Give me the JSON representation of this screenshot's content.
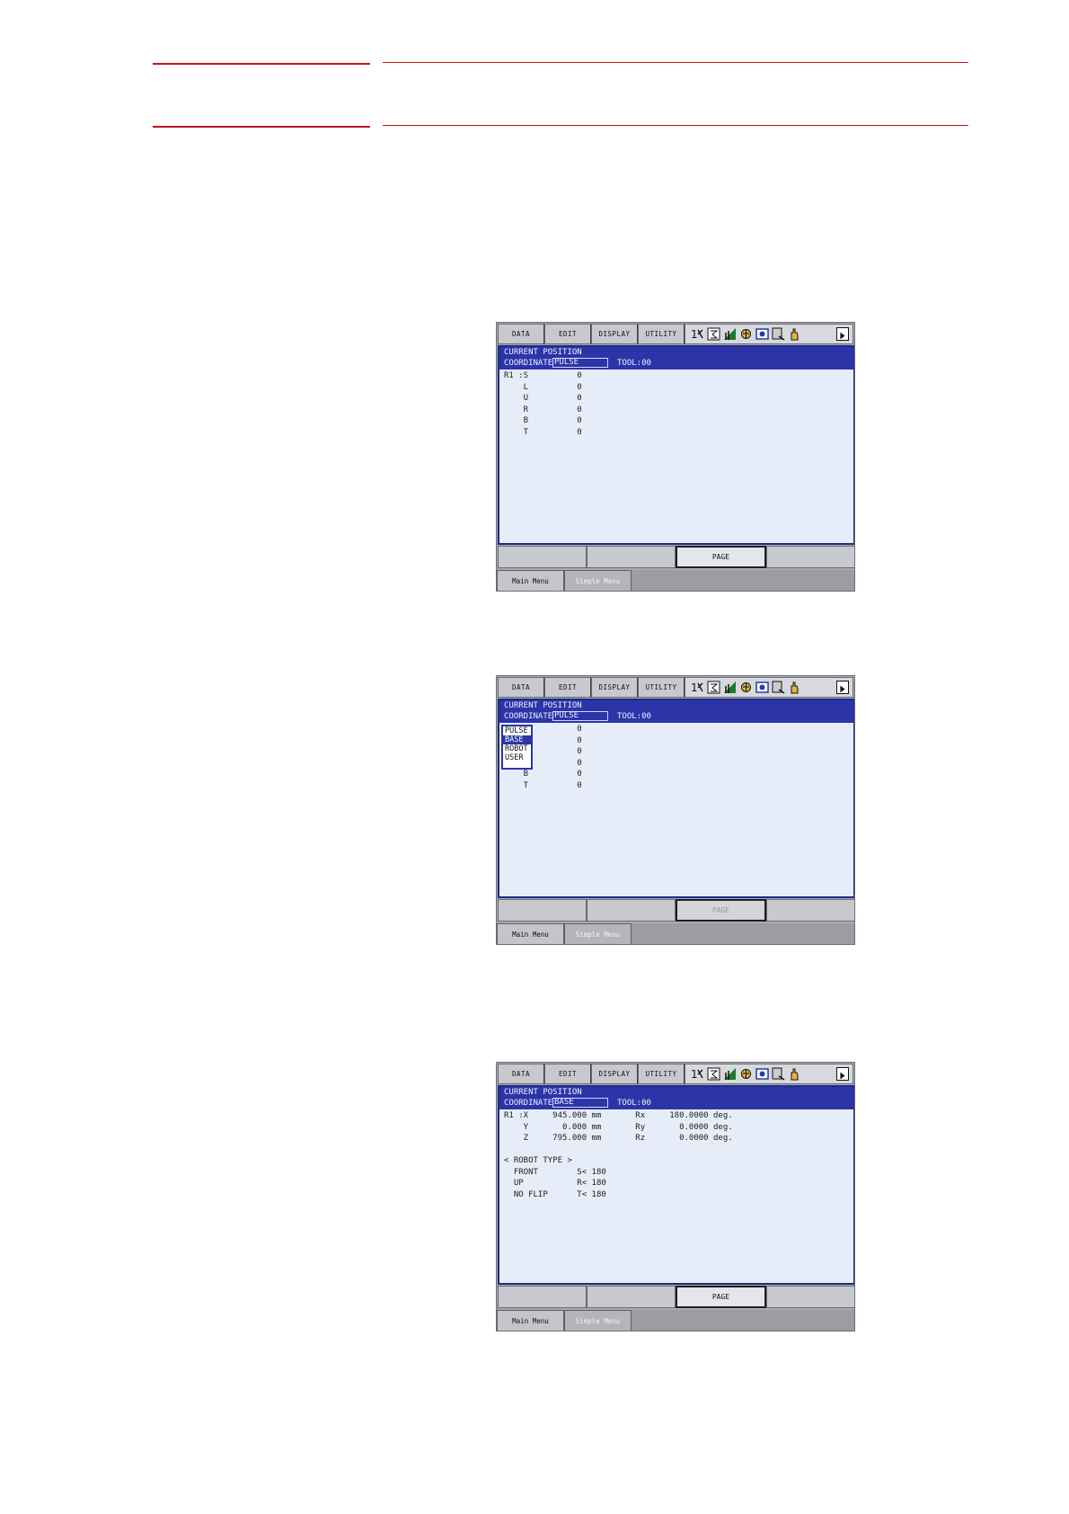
{
  "menu": {
    "data": "DATA",
    "edit": "EDIT",
    "display": "DISPLAY",
    "utility": "UTILITY"
  },
  "icons": [
    "number-switch-icon",
    "edit-icon",
    "signal-icon",
    "gear-sync-icon",
    "camera-icon",
    "jog-icon",
    "hand-icon"
  ],
  "function_keys": [
    "",
    "",
    "PAGE",
    ""
  ],
  "bottom": {
    "main": "Main Menu",
    "simple": "Simple Menu"
  },
  "screens": [
    {
      "title": "CURRENT POSITION",
      "coord_label": "COORDINATE",
      "coord_value": "PULSE",
      "tool": "TOOL:00",
      "lines": [
        "R1 :S          0",
        "    L          0",
        "    U          0",
        "    R          0",
        "    B          0",
        "    T          0"
      ]
    },
    {
      "title": "CURRENT POSITION",
      "coord_label": "COORDINATE",
      "coord_value": "PULSE",
      "tool": "TOOL:00",
      "dropdown": [
        "PULSE",
        "BASE",
        "ROBOT",
        "USER"
      ],
      "dropdown_selected": "BASE",
      "lines": [
        "               0",
        "               0",
        "               0",
        "               0",
        "    B          0",
        "    T          0"
      ]
    },
    {
      "title": "CURRENT POSITION",
      "coord_label": "COORDINATE",
      "coord_value": "BASE",
      "tool": "TOOL:00",
      "lines": [
        "R1 :X     945.000 mm       Rx     180.0000 deg.",
        "    Y       0.000 mm       Ry       0.0000 deg.",
        "    Z     795.000 mm       Rz       0.0000 deg.",
        "",
        "< ROBOT TYPE >",
        "  FRONT        S< 180",
        "  UP           R< 180",
        "  NO FLIP      T< 180"
      ]
    }
  ]
}
